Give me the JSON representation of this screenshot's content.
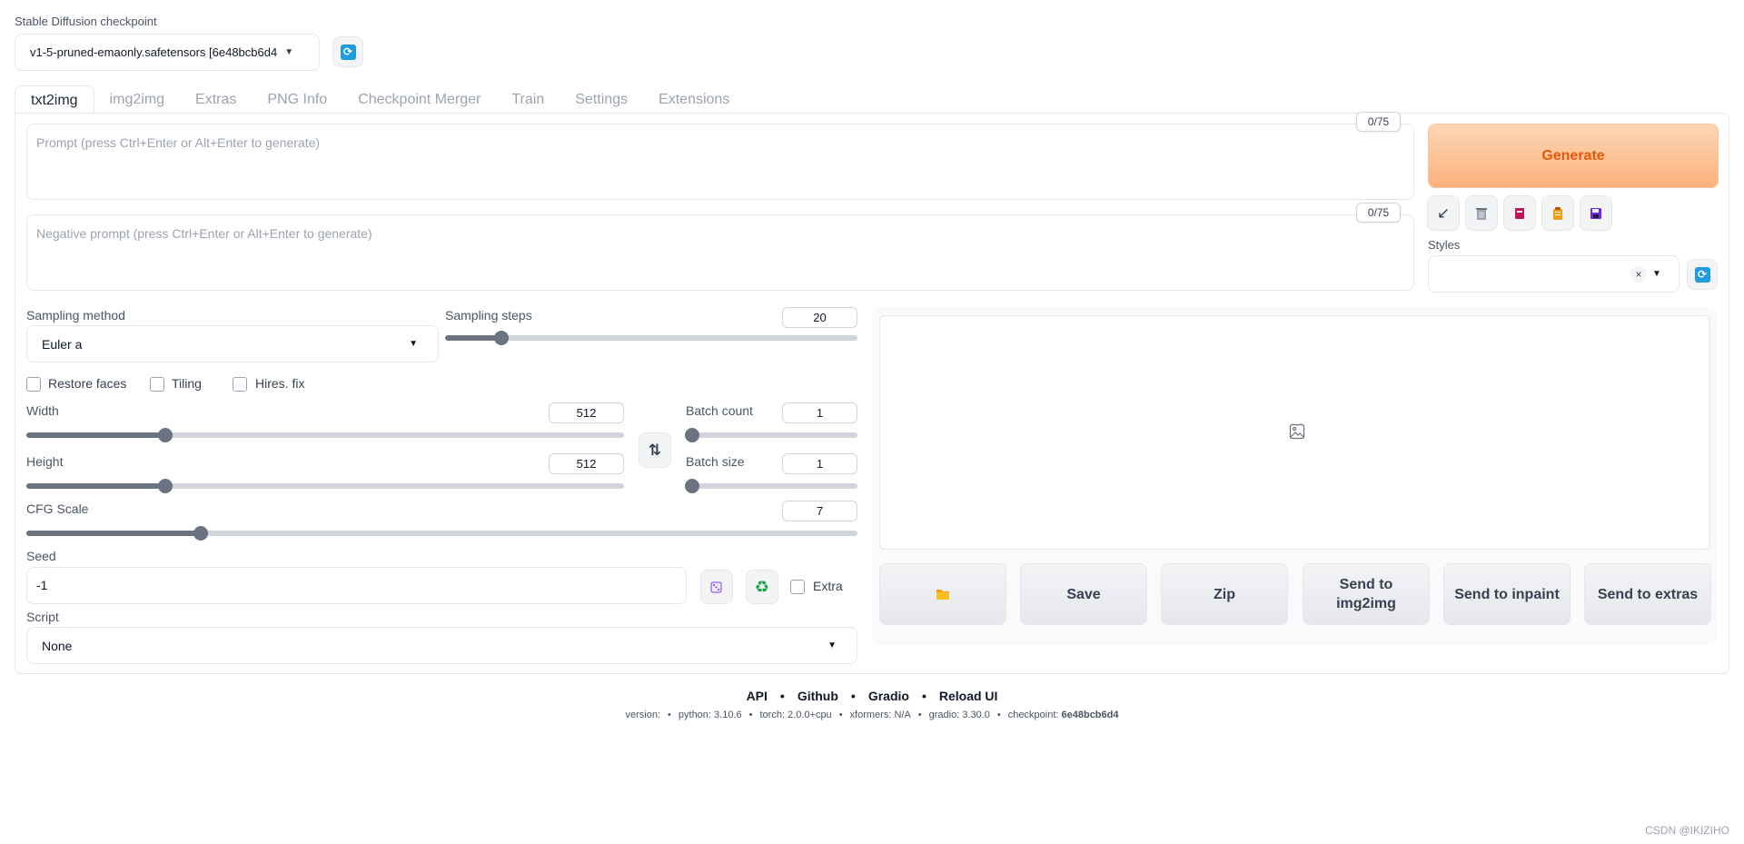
{
  "checkpoint": {
    "label": "Stable Diffusion checkpoint",
    "value": "v1-5-pruned-emaonly.safetensors [6e48bcb6d4"
  },
  "tabs": [
    {
      "label": "txt2img",
      "active": true
    },
    {
      "label": "img2img"
    },
    {
      "label": "Extras"
    },
    {
      "label": "PNG Info"
    },
    {
      "label": "Checkpoint Merger"
    },
    {
      "label": "Train"
    },
    {
      "label": "Settings"
    },
    {
      "label": "Extensions"
    }
  ],
  "prompt": {
    "placeholder": "Prompt (press Ctrl+Enter or Alt+Enter to generate)",
    "counter": "0/75"
  },
  "negative_prompt": {
    "placeholder": "Negative prompt (press Ctrl+Enter or Alt+Enter to generate)",
    "counter": "0/75"
  },
  "generate_label": "Generate",
  "tool_icons": [
    "arrow-icon",
    "trash-icon",
    "red-book-icon",
    "clipboard-icon",
    "save-disk-icon"
  ],
  "styles": {
    "label": "Styles",
    "clear": "×"
  },
  "sampling_method": {
    "label": "Sampling method",
    "value": "Euler a"
  },
  "sampling_steps": {
    "label": "Sampling steps",
    "value": "20",
    "fraction": 0.136
  },
  "checkboxes": {
    "restore_faces": "Restore faces",
    "tiling": "Tiling",
    "hires_fix": "Hires. fix"
  },
  "width": {
    "label": "Width",
    "value": "512",
    "fraction": 0.232
  },
  "height": {
    "label": "Height",
    "value": "512",
    "fraction": 0.232
  },
  "batch_count": {
    "label": "Batch count",
    "value": "1",
    "fraction": 0.0
  },
  "batch_size": {
    "label": "Batch size",
    "value": "1",
    "fraction": 0.0
  },
  "cfg_scale": {
    "label": "CFG Scale",
    "value": "7",
    "fraction": 0.21
  },
  "seed": {
    "label": "Seed",
    "value": "-1",
    "extra_label": "Extra"
  },
  "script": {
    "label": "Script",
    "value": "None"
  },
  "actions": {
    "folder_icon": "folder-icon",
    "save": "Save",
    "zip": "Zip",
    "send_img2img_line1": "Send to",
    "send_img2img_line2": "img2img",
    "send_inpaint": "Send to inpaint",
    "send_extras": "Send to extras"
  },
  "footer": {
    "links": [
      "API",
      "Github",
      "Gradio",
      "Reload UI"
    ],
    "version_label": "version:",
    "python": "python: 3.10.6",
    "torch": "torch: 2.0.0+cpu",
    "xformers": "xformers: N/A",
    "gradio": "gradio: 3.30.0",
    "checkpoint_label": "checkpoint:",
    "checkpoint_hash": "6e48bcb6d4"
  },
  "watermark": "CSDN @IKIZIHO",
  "colors": {
    "accent_orange": "#ea580c",
    "refresh_blue": "#1f9ce0",
    "slider": "#6b7280"
  }
}
